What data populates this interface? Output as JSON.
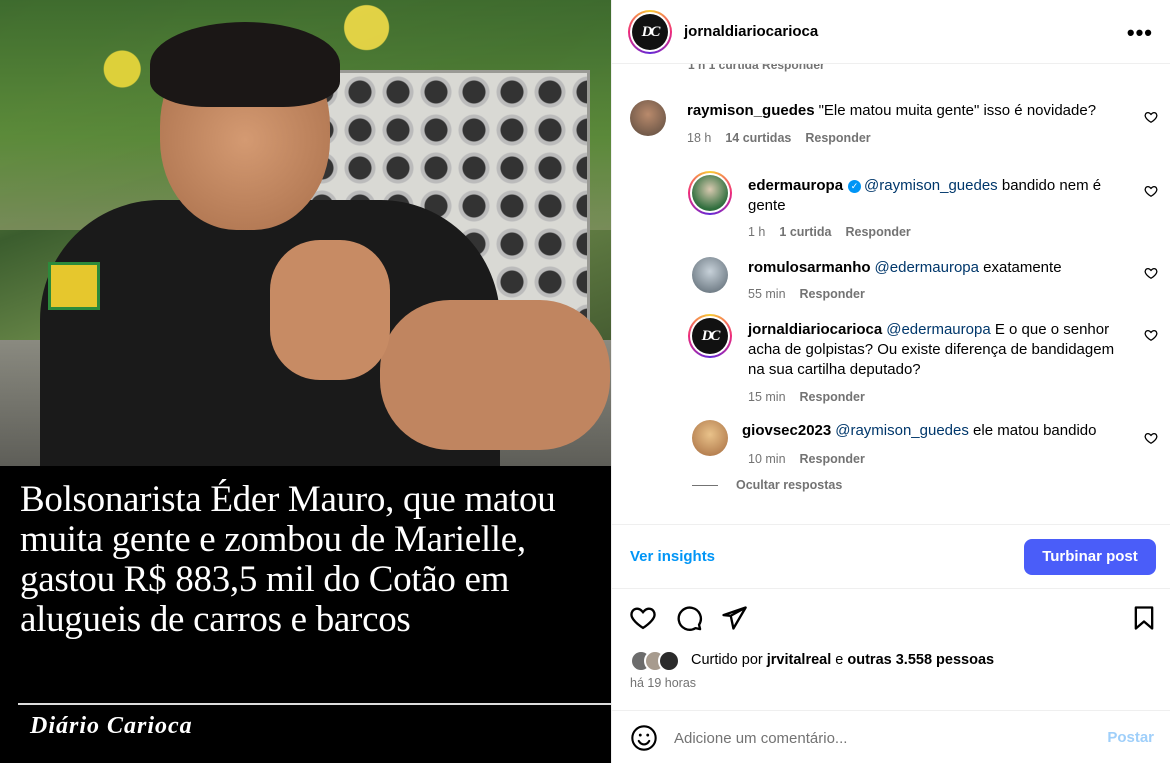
{
  "media": {
    "headline": "Bolsonarista Éder Mauro, que matou muita gente e zombou de Marielle, gastou R$ 883,5 mil do Cotão em alugueis de carros e barcos",
    "brand": "Diário Carioca"
  },
  "header": {
    "username": "jornaldiariocarioca",
    "avatar_text": "DC",
    "more_icon": "more-horizontal-icon"
  },
  "comments": {
    "partial_meta": "1 h    1 curtida    Responder",
    "items": [
      {
        "user": "raymison_guedes",
        "text": "\"Ele matou muita gente\" isso é novidade?",
        "time": "18 h",
        "likes": "14 curtidas",
        "reply": "Responder"
      }
    ],
    "replies": [
      {
        "user": "edermauropa",
        "verified": true,
        "mention": "@raymison_guedes",
        "text": " bandido nem é gente",
        "time": "1 h",
        "likes": "1 curtida",
        "reply": "Responder"
      },
      {
        "user": "romulosarmanho",
        "mention": "@edermauropa",
        "text": " exatamente",
        "time": "55 min",
        "reply": "Responder"
      },
      {
        "user": "jornaldiariocarioca",
        "mention": "@edermauropa",
        "text": " E o que o senhor acha de golpistas? Ou existe diferença de bandidagem na sua cartilha deputado?",
        "time": "15 min",
        "reply": "Responder"
      },
      {
        "user": "giovsec2023",
        "mention": "@raymison_guedes",
        "text": " ele matou bandido",
        "time": "10 min",
        "reply": "Responder"
      }
    ],
    "hide_replies": "Ocultar respostas"
  },
  "actions": {
    "insights": "Ver insights",
    "boost": "Turbinar post",
    "icons": [
      "heart-icon",
      "comment-icon",
      "share-icon",
      "bookmark-icon"
    ]
  },
  "likes": {
    "prefix": "Curtido por ",
    "user": "jrvitalreal",
    "middle": " e ",
    "others": "outras 3.558 pessoas",
    "time": "há 19 horas"
  },
  "composer": {
    "placeholder": "Adicione um comentário...",
    "post": "Postar"
  },
  "colors": {
    "accent_blue": "#0095f6",
    "boost_button": "#4a5df9",
    "mention": "#00376b",
    "muted": "#737373"
  }
}
